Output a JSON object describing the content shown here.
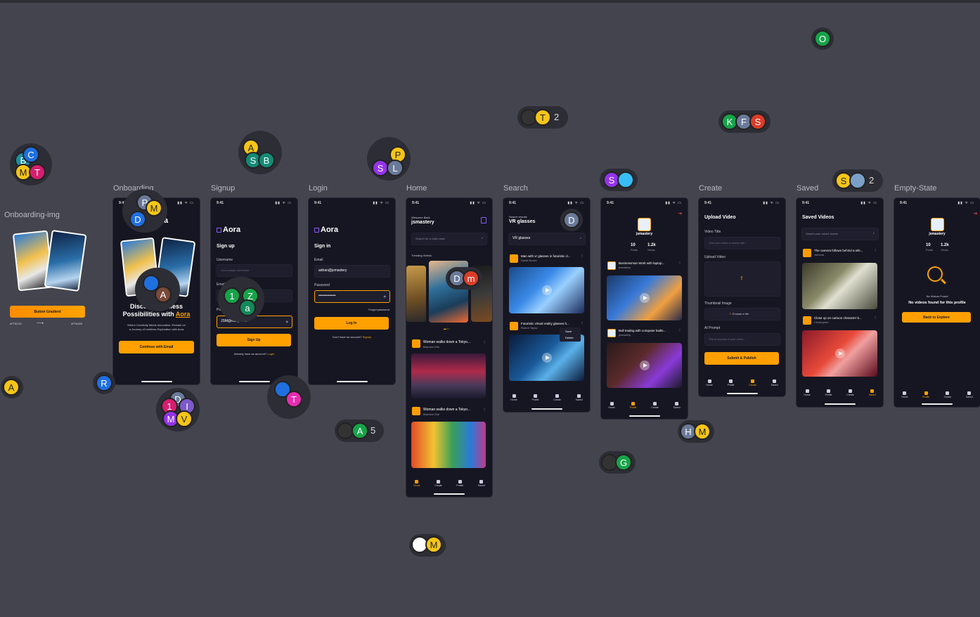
{
  "labels": {
    "onboarding_img": "Onboarding-img",
    "onboarding": "Onboarding",
    "signup": "Signup",
    "login": "Login",
    "home": "Home",
    "search": "Search",
    "create": "Create",
    "saved": "Saved",
    "empty_state": "Empty-State"
  },
  "status": {
    "time": "9:41",
    "signal": "▮▮ ᯤ ▭"
  },
  "onboarding_img": {
    "button_label": "Button Gradient",
    "color_from": "#FF8C00",
    "color_to": "#FFA300",
    "arrow": "⟶"
  },
  "onboarding": {
    "headline_1": "Discover Endless",
    "headline_2": "Possibilities with",
    "brand": "Aora",
    "brand_partial": "a",
    "tagline_1": "Where Creativity Meets Innovation: Embark on",
    "tagline_2": "a Journey of Limitless Exploration with Aora",
    "cta": "Continue with Email"
  },
  "signup": {
    "brand": "Aora",
    "title": "Sign up",
    "username_label": "Username",
    "username_placeholder": "Your unique username",
    "email_label": "Email",
    "password_label": "Password",
    "password_value": "JSM@elany2kkk",
    "button": "Sign Up",
    "footer": "Already have an account?",
    "footer_link": "Login"
  },
  "login": {
    "brand": "Aora",
    "title": "Sign in",
    "email_label": "Email",
    "email_value": "adrian@jsmastery",
    "password_label": "Password",
    "password_value": "••••••••••••••",
    "forgot": "Forgot password",
    "button": "Log In",
    "footer": "Don't have an account?",
    "footer_link": "Signup"
  },
  "home": {
    "welcome": "Welcome Back",
    "user": "jsmastery",
    "search_placeholder": "Search for a video topic",
    "trending": "Trending Videos",
    "posts": [
      {
        "title": "Woman walks down a Tokyo...",
        "author": "Brandon Etie"
      },
      {
        "title": "Woman walks down a Tokyo...",
        "author": "Brandon Etie"
      }
    ]
  },
  "search": {
    "results_for": "Search results",
    "query": "VR glasses",
    "search_value": "VR glasses",
    "posts": [
      {
        "title": "Man with vr glasses in futuristic cl...",
        "author": "David Brown"
      },
      {
        "title": "Futuristic virtual reality glasses h...",
        "author": "Robert Taylor"
      }
    ],
    "menu_save": "Save",
    "menu_delete": "Delete"
  },
  "profile": {
    "username": "jsmastery",
    "posts_count": "10",
    "posts_label": "Posts",
    "views_count": "1.2k",
    "views_label": "Views",
    "posts": [
      {
        "title": "Businessman Work with laptop...",
        "author": "jsmastery"
      },
      {
        "title": "Bull trading with computer builts...",
        "author": "jsmastery"
      }
    ]
  },
  "create": {
    "title": "Upload Video",
    "video_title_label": "Video Title",
    "video_title_placeholder": "Give your video a catchy title...",
    "upload_label": "Upload Video",
    "thumb_label": "Thumbnail Image",
    "choose_file": "Choose a file",
    "prompt_label": "AI Prompt",
    "prompt_placeholder": "The AI prompt of your video...",
    "button": "Submit & Publish"
  },
  "saved": {
    "title": "Saved Videos",
    "search_placeholder": "Search your saved videos",
    "posts": [
      {
        "title": "The camera follows behind a whi...",
        "author": "Jefrecia"
      },
      {
        "title": "Close up on cartoon character b...",
        "author": "Christopher"
      }
    ]
  },
  "empty": {
    "username": "jsmastery",
    "posts_count": "10",
    "posts_label": "Posts",
    "views_count": "1.2k",
    "views_label": "Views",
    "small": "No Videos Found",
    "message": "No videos found for this profile",
    "button": "Back to Explore"
  },
  "tabs": {
    "home": "Home",
    "profile": "Profile",
    "create": "Create",
    "saved": "Saved"
  },
  "cursors": {
    "c1": "B",
    "c2": "C",
    "c3": "M",
    "c4": "T",
    "c5": "A",
    "c6": "S",
    "c7": "B",
    "c8": "P",
    "c9": "S",
    "c10": "L",
    "c11": "T",
    "c12": "2",
    "c13": "K",
    "c14": "F",
    "c15": "S",
    "c16": "O",
    "c17": "S",
    "c18": "S",
    "c19": "2",
    "c20": "A",
    "c21": "R",
    "c22": "P",
    "c23": "M",
    "c24": "D",
    "c25": "A",
    "c26": "1",
    "c27": "Z",
    "c28": "a",
    "c29": "D",
    "c30": "m",
    "c31": "D",
    "c32": "T",
    "c33": "D",
    "c34": "1",
    "c35": "I",
    "c36": "M",
    "c37": "V",
    "c38": "A",
    "c39": "5",
    "c40": "H",
    "c41": "M",
    "c42": "G",
    "c43": "M"
  },
  "colors": {
    "canvas": "#44444f",
    "phone_bg": "#161622",
    "accent": "#ffa001",
    "input_bg": "#1e1e2d"
  }
}
